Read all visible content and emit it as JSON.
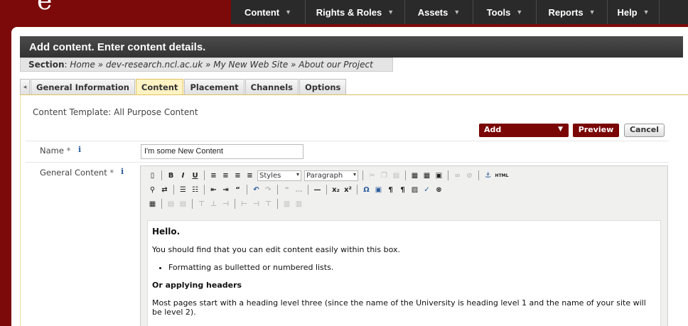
{
  "logo": {
    "fragment": "e"
  },
  "topnav": {
    "items": [
      {
        "label": "Content",
        "width": 105
      },
      {
        "label": "Rights & Roles",
        "width": 140
      },
      {
        "label": "Assets",
        "width": 96
      },
      {
        "label": "Tools",
        "width": 89
      },
      {
        "label": "Reports",
        "width": 100
      },
      {
        "label": "Help",
        "width": 73
      }
    ]
  },
  "page": {
    "title": "Add content. Enter content details.",
    "section_label": "Section",
    "section_path": "Home » dev-research.ncl.ac.uk » My New Web Site » About our Project"
  },
  "tabs": [
    {
      "label": "General Information",
      "active": false
    },
    {
      "label": "Content",
      "active": true
    },
    {
      "label": "Placement",
      "active": false
    },
    {
      "label": "Channels",
      "active": false
    },
    {
      "label": "Options",
      "active": false
    }
  ],
  "form": {
    "template_label": "Content Template: All Purpose Content",
    "add_label": "Add",
    "preview_label": "Preview",
    "cancel_label": "Cancel",
    "name_label": "Name",
    "name_value": "I'm some New Content",
    "general_content_label": "General Content",
    "required_marker": "*",
    "info_marker": "i"
  },
  "editor": {
    "styles_label": "Styles",
    "format_label": "Paragraph",
    "html_label": "HTML",
    "heading": "Hello.",
    "para1": "You should find that you can edit content easily within this box.",
    "bullet1": "Formatting as bulletted or numbered lists.",
    "subheading": "Or applying headers",
    "para2": "Most pages start with a heading level three (since the name of the University is heading level 1 and the name of your site will be level 2)."
  },
  "colors": {
    "brand": "#7d0a0a",
    "nav": "#2a2a2a",
    "accent_button": "#7a0606",
    "active_tab": "#fff3c4"
  }
}
